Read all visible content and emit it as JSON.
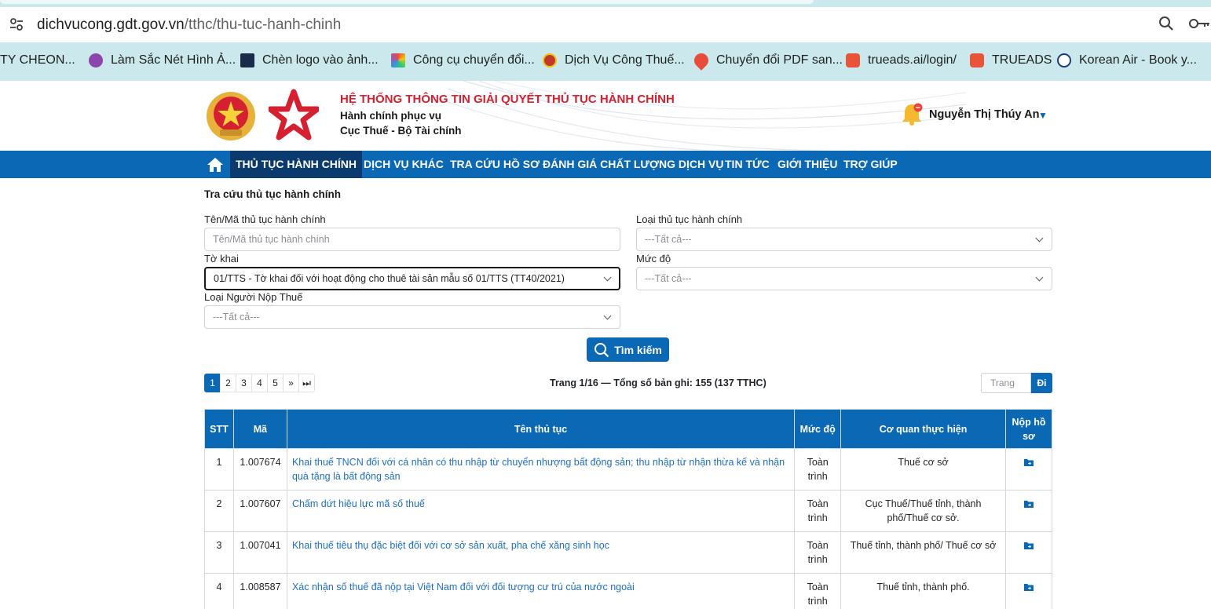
{
  "browser": {
    "url_host": "dichvucong.gdt.gov.vn",
    "url_path": "/tthc/thu-tuc-hanh-chinh",
    "bookmarks": [
      {
        "label": "TY CHEON...",
        "color": ""
      },
      {
        "label": "Làm Sắc Nét Hình Ả...",
        "color": "#8e44ad"
      },
      {
        "label": "Chèn logo vào ảnh...",
        "color": "#1a2b4a"
      },
      {
        "label": "Công cụ chuyển đổi...",
        "color": "#e67e22"
      },
      {
        "label": "Dịch Vụ Công Thuế...",
        "color": "#c0392b"
      },
      {
        "label": "Chuyển đổi PDF san...",
        "color": "#e74c3c"
      },
      {
        "label": "trueads.ai/login/",
        "color": "#e8543a"
      },
      {
        "label": "TRUEADS",
        "color": "#e8543a"
      },
      {
        "label": "Korean Air - Book y...",
        "color": "#1a3d7c"
      }
    ]
  },
  "header": {
    "system_title": "HỆ THỐNG THÔNG TIN GIẢI QUYẾT THỦ TỤC HÀNH CHÍNH",
    "subtitle1": "Hành chính phục vụ",
    "subtitle2": "Cục Thuế - Bộ Tài chính",
    "user_name": "Nguyễn Thị Thúy An",
    "accent": "#d4202f",
    "brand": "#0b68b5"
  },
  "nav": {
    "items": [
      {
        "label": "THỦ TỤC HÀNH CHÍNH",
        "active": true
      },
      {
        "label": "DỊCH VỤ KHÁC"
      },
      {
        "label": "TRA CỨU HỒ SƠ"
      },
      {
        "label": "ĐÁNH GIÁ CHẤT LƯỢNG DỊCH VỤ"
      },
      {
        "label": "TIN TỨC"
      },
      {
        "label": "GIỚI THIỆU"
      },
      {
        "label": "TRỢ GIÚP"
      }
    ]
  },
  "search": {
    "heading": "Tra cứu thủ tục hành chính",
    "name_label": "Tên/Mã thủ tục hành chính",
    "name_placeholder": "Tên/Mã thủ tục hành chính",
    "type_label": "Loại thủ tục hành chính",
    "type_value": "---Tất cả---",
    "form_label": "Tờ khai",
    "form_value": "01/TTS - Tờ khai đối với hoạt động cho thuê tài sản mẫu số 01/TTS (TT40/2021)",
    "level_label": "Mức độ",
    "level_value": "---Tất cả---",
    "payer_label": "Loại Người Nộp Thuế",
    "payer_value": "---Tất cả---",
    "button": "Tìm kiếm"
  },
  "pagination": {
    "pages": [
      "1",
      "2",
      "3",
      "4",
      "5",
      "»",
      "⏭"
    ],
    "info": "Trang 1/16 — Tổng số bản ghi: 155 (137 TTHC)",
    "goto_placeholder": "Trang",
    "goto_button": "Đi"
  },
  "table": {
    "headers": {
      "stt": "STT",
      "ma": "Mã",
      "ten": "Tên thủ tục",
      "muc_do": "Mức độ",
      "co_quan": "Cơ quan thực hiện",
      "nop": "Nộp hồ sơ"
    },
    "rows": [
      {
        "stt": "1",
        "ma": "1.007674",
        "ten": "Khai thuế TNCN đối với cá nhân có thu nhập từ chuyển nhượng bất động sản; thu nhập từ nhận thừa kế và nhận quà tặng là bất động sản",
        "muc_do": "Toàn trình",
        "co_quan": "Thuế cơ sở"
      },
      {
        "stt": "2",
        "ma": "1.007607",
        "ten": "Chấm dứt hiệu lực mã số thuế",
        "muc_do": "Toàn trình",
        "co_quan": "Cục Thuế/Thuế tỉnh, thành phố/Thuế cơ sở."
      },
      {
        "stt": "3",
        "ma": "1.007041",
        "ten": "Khai thuế tiêu thụ đặc biệt đối với cơ sở sản xuất, pha chế xăng sinh học",
        "muc_do": "Toàn trình",
        "co_quan": "Thuế tỉnh, thành phố/ Thuế cơ sở"
      },
      {
        "stt": "4",
        "ma": "1.008587",
        "ten": "Xác nhận số thuế đã nộp tại Việt Nam đối với đối tượng cư trú của nước ngoài",
        "muc_do": "Toàn trình",
        "co_quan": "Thuế tỉnh, thành phố."
      }
    ]
  }
}
